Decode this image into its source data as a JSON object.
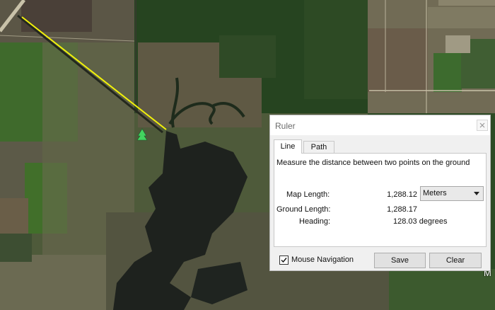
{
  "map": {
    "view": "satellite",
    "ruler_line_color": "#f2f20a",
    "marker_icon": "tree-placemark-icon",
    "marker_color": "#43d35f",
    "edge_label": "M"
  },
  "ruler": {
    "title": "Ruler",
    "close_icon": "close-icon",
    "tabs": [
      {
        "label": "Line",
        "active": true
      },
      {
        "label": "Path",
        "active": false
      }
    ],
    "description": "Measure the distance between two points on the ground",
    "map_length_label": "Map Length:",
    "map_length_value": "1,288.12",
    "unit_selected": "Meters",
    "ground_length_label": "Ground Length:",
    "ground_length_value": "1,288.17",
    "heading_label": "Heading:",
    "heading_value": "128.03 degrees",
    "mouse_navigation_label": "Mouse Navigation",
    "mouse_navigation_checked": true,
    "save_label": "Save",
    "clear_label": "Clear"
  }
}
